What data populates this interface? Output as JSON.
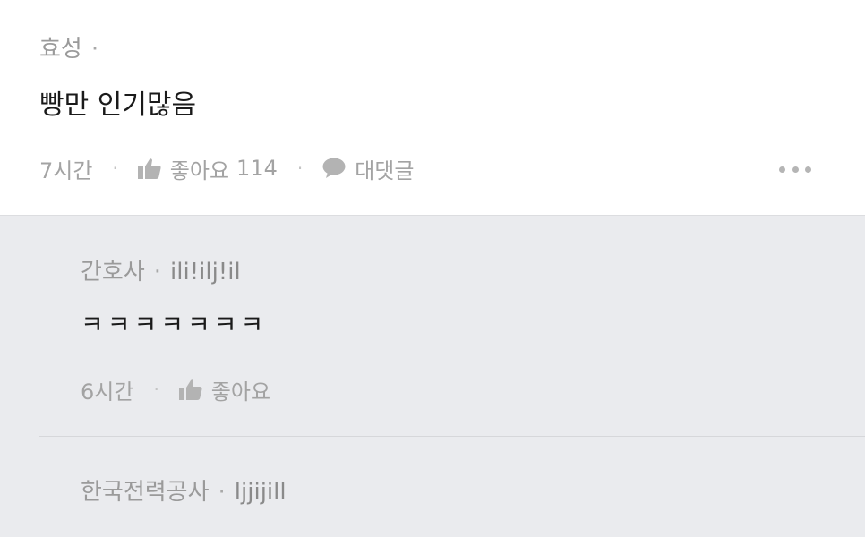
{
  "comment": {
    "author": "효성",
    "separator": "·",
    "handle_obscured": "",
    "text": "빵만 인기많음",
    "time": "7시간",
    "like_label": "좋아요",
    "like_count": "114",
    "reply_label": "대댓글"
  },
  "replies": [
    {
      "author": "간호사",
      "separator": "·",
      "handle": "ili!ilj!il",
      "text": "ㅋㅋㅋㅋㅋㅋㅋ",
      "time": "6시간",
      "like_label": "좋아요"
    },
    {
      "author": "한국전력공사",
      "separator": "·",
      "handle": "ljjijill"
    }
  ],
  "action_separator": "·",
  "icons": {
    "like": "thumbs-up-icon",
    "reply": "speech-bubble-icon",
    "more": "more-dots-icon"
  },
  "colors": {
    "reply_background": "#eaebee",
    "meta_text": "#9a9a9a",
    "body_text": "#1a1a1a"
  }
}
